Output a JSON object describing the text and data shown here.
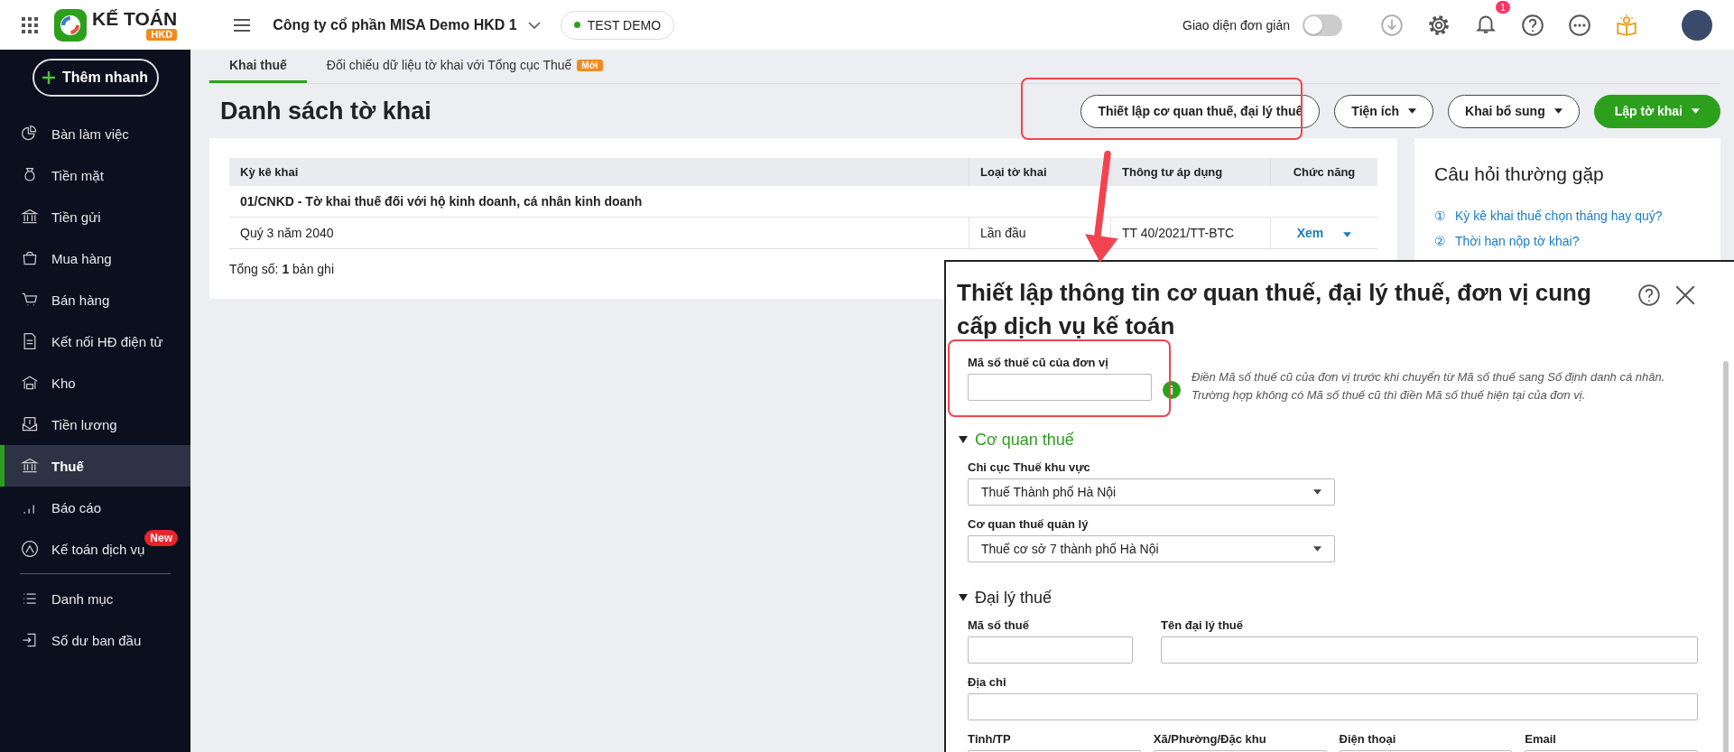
{
  "header": {
    "logo": {
      "name": "KẾ TOÁN",
      "sub": "HKD"
    },
    "company": "Công ty cổ phần MISA Demo HKD 1",
    "env_badge": "TEST DEMO",
    "simple_mode": {
      "label": "Giao diện đơn giản",
      "on": false
    },
    "notification_count": "1"
  },
  "sidebar": {
    "quick_add": "Thêm nhanh",
    "items": [
      {
        "label": "Bàn làm việc",
        "selected": false
      },
      {
        "label": "Tiền mặt",
        "selected": false
      },
      {
        "label": "Tiền gửi",
        "selected": false
      },
      {
        "label": "Mua hàng",
        "selected": false
      },
      {
        "label": "Bán hàng",
        "selected": false
      },
      {
        "label": "Kết nối HĐ điện tử",
        "selected": false
      },
      {
        "label": "Kho",
        "selected": false
      },
      {
        "label": "Tiền lương",
        "selected": false
      },
      {
        "label": "Thuế",
        "selected": true
      },
      {
        "label": "Báo cáo",
        "selected": false
      },
      {
        "label": "Kế toán dịch vụ",
        "selected": false,
        "badge": "New"
      }
    ],
    "bottom_items": [
      {
        "label": "Danh mục",
        "selected": false
      },
      {
        "label": "Số dư ban đầu",
        "selected": false
      }
    ]
  },
  "tabs": [
    {
      "label": "Khai thuế",
      "selected": true
    },
    {
      "label": "Đối chiếu dữ liệu tờ khai với Tổng cục Thuế",
      "selected": false,
      "badge": "Mới"
    }
  ],
  "page_title": "Danh sách tờ khai",
  "toolbar": [
    {
      "label": "Thiết lập cơ quan thuế, đại lý thuế",
      "kind": "outline"
    },
    {
      "label": "Tiện ích",
      "kind": "dropdown"
    },
    {
      "label": "Khai bổ sung",
      "kind": "dropdown"
    },
    {
      "label": "Lập tờ khai",
      "kind": "primary"
    }
  ],
  "table": {
    "columns": [
      "Kỳ kê khai",
      "Loại tờ khai",
      "Thông tư áp dụng",
      "Chức năng"
    ],
    "groups": [
      {
        "title": "01/CNKD - Tờ khai thuế đối với hộ kinh doanh, cá nhân kinh doanh",
        "rows": [
          {
            "period": "Quý 3 năm 2040",
            "type": "Lần đầu",
            "circular": "TT 40/2021/TT-BTC",
            "action": "Xem"
          }
        ]
      }
    ],
    "footer": "Tổng số: **1** bản ghi"
  },
  "faq": {
    "title": "Câu hỏi thường gặp",
    "items": [
      {
        "number": "①",
        "text": "Kỳ kê khai thuế chọn tháng hay quý?"
      },
      {
        "number": "②",
        "text": "Thời hạn nộp tờ khai?"
      }
    ]
  },
  "dialog": {
    "title": "Thiết lập thông tin cơ quan thuế, đại lý thuế, đơn vị cung cấp dịch vụ kế toán",
    "old_tax_code": {
      "label": "Mã số thuế cũ của đơn vị",
      "hint": "Điền Mã số thuế cũ của đơn vị trước khi chuyển từ Mã số thuế sang Số định danh cá nhân. Trường hợp không có Mã số thuế cũ thì điền Mã số thuế hiện tại của đơn vị."
    },
    "sections": [
      {
        "title": "Cơ quan thuế",
        "expanded": true,
        "active": true,
        "rows": [
          [
            {
              "label": "Chi cục Thuế khu vực",
              "kind": "select",
              "value": "Thuế Thành phố Hà Nội"
            }
          ],
          [
            {
              "label": "Cơ quan thuế quản lý",
              "kind": "select",
              "value": "Thuế cơ sở 7 thành phố Hà Nội"
            }
          ]
        ]
      },
      {
        "title": "Đại lý thuế",
        "expanded": true,
        "active": false,
        "rows": [
          [
            {
              "label": "Mã số thuế",
              "kind": "text"
            },
            {
              "label": "Tên đại lý thuế",
              "kind": "text"
            }
          ],
          [
            {
              "label": "Địa chỉ",
              "kind": "text"
            }
          ],
          [
            {
              "label": "Tỉnh/TP",
              "kind": "text"
            },
            {
              "label": "Xã/Phường/Đặc khu",
              "kind": "text"
            },
            {
              "label": "Điện thoại",
              "kind": "text"
            },
            {
              "label": "Email",
              "kind": "text"
            }
          ]
        ]
      }
    ]
  }
}
